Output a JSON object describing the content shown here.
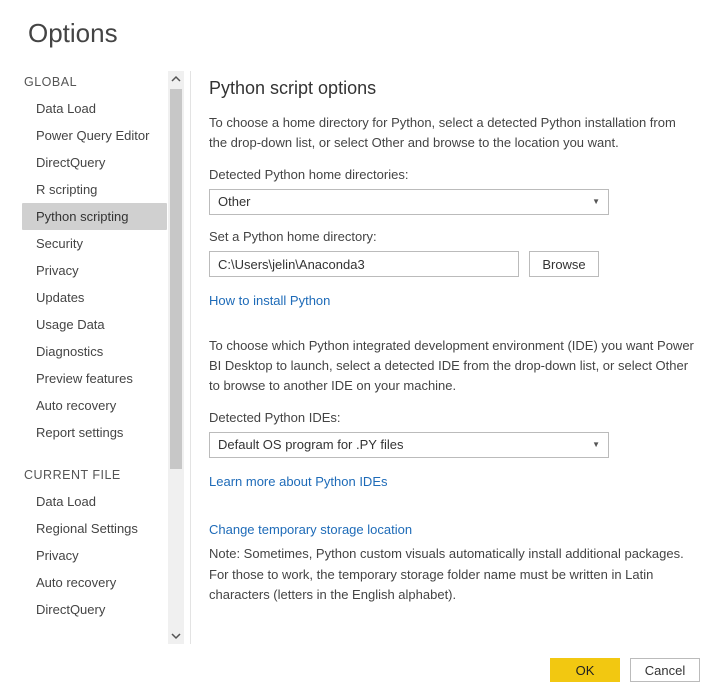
{
  "title": "Options",
  "sidebar": {
    "global_label": "GLOBAL",
    "current_file_label": "CURRENT FILE",
    "global_items": [
      "Data Load",
      "Power Query Editor",
      "DirectQuery",
      "R scripting",
      "Python scripting",
      "Security",
      "Privacy",
      "Updates",
      "Usage Data",
      "Diagnostics",
      "Preview features",
      "Auto recovery",
      "Report settings"
    ],
    "current_file_items": [
      "Data Load",
      "Regional Settings",
      "Privacy",
      "Auto recovery",
      "DirectQuery"
    ],
    "selected": "Python scripting"
  },
  "content": {
    "heading": "Python script options",
    "intro": "To choose a home directory for Python, select a detected Python installation from the drop-down list, or select Other and browse to the location you want.",
    "detected_dirs_label": "Detected Python home directories:",
    "detected_dirs_value": "Other",
    "set_home_label": "Set a Python home directory:",
    "home_path": "C:\\Users\\jelin\\Anaconda3",
    "browse_label": "Browse",
    "install_link": "How to install Python",
    "ide_intro": "To choose which Python integrated development environment (IDE) you want Power BI Desktop to launch, select a detected IDE from the drop-down list, or select Other to browse to another IDE on your machine.",
    "ide_label": "Detected Python IDEs:",
    "ide_value": "Default OS program for .PY files",
    "ide_link": "Learn more about Python IDEs",
    "storage_link": "Change temporary storage location",
    "storage_note": "Note: Sometimes, Python custom visuals automatically install additional packages. For those to work, the temporary storage folder name must be written in Latin characters (letters in the English alphabet)."
  },
  "footer": {
    "ok": "OK",
    "cancel": "Cancel"
  }
}
